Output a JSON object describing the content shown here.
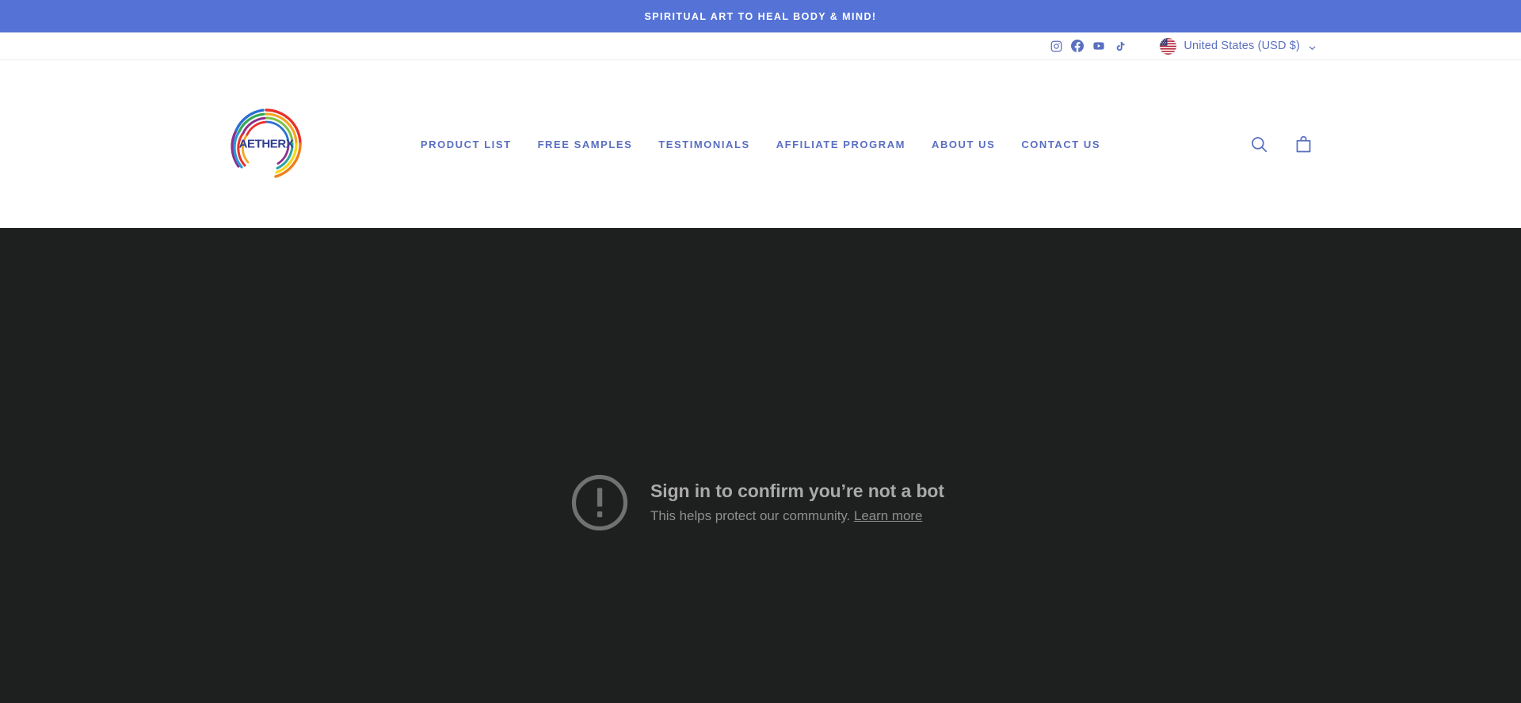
{
  "announcement": {
    "text": "SPIRITUAL ART TO HEAL BODY & MIND!",
    "background_color": "#5573d6",
    "text_color": "#ffffff"
  },
  "utility_bar": {
    "social_links": [
      {
        "name": "instagram-icon",
        "label": "Instagram"
      },
      {
        "name": "facebook-icon",
        "label": "Facebook"
      },
      {
        "name": "youtube-icon",
        "label": "YouTube"
      },
      {
        "name": "tiktok-icon",
        "label": "TikTok"
      }
    ],
    "locale": {
      "flag": "us-flag-icon",
      "label": "United States (USD $)",
      "chevron": "chevron-down-icon"
    }
  },
  "header": {
    "logo": {
      "name": "aetherx-logo",
      "wordmark": "AETHERX",
      "alt": "AetherX rainbow circle logo"
    },
    "nav_items": [
      {
        "label": "PRODUCT LIST",
        "key": "product-list"
      },
      {
        "label": "FREE SAMPLES",
        "key": "free-samples"
      },
      {
        "label": "TESTIMONIALS",
        "key": "testimonials"
      },
      {
        "label": "AFFILIATE PROGRAM",
        "key": "affiliate-program"
      },
      {
        "label": "ABOUT US",
        "key": "about-us"
      },
      {
        "label": "CONTACT US",
        "key": "contact-us"
      }
    ],
    "actions": [
      {
        "name": "search-icon",
        "label": "Search"
      },
      {
        "name": "cart-icon",
        "label": "Cart"
      }
    ],
    "link_color": "#5a6fc0"
  },
  "video_embed": {
    "background_color": "#1e1f1f",
    "notice": {
      "icon": "alert-circle-icon",
      "title": "Sign in to confirm you’re not a bot",
      "subtitle": "This helps protect our community.",
      "link_text": "Learn more"
    }
  }
}
